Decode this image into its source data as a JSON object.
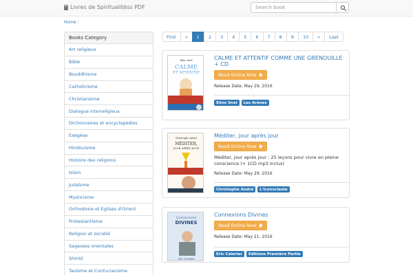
{
  "header": {
    "brand": "Livres de Spiritualitéss PDF",
    "search_placeholder": "Search book"
  },
  "breadcrumb": {
    "home": "Home",
    "separator": "/"
  },
  "sidebar": {
    "title": "Books Category",
    "items": [
      "Art religieux",
      "Bible",
      "Bouddhisme",
      "Catholicisme",
      "Christianisme",
      "Dialogue interreligieux",
      "Dictionnaires et encyclopédies",
      "Exégèse",
      "Hindouisme",
      "Histoire des religions",
      "Islam",
      "Judaïsme",
      "Mysticisme",
      "Orthodoxie et Eglises d'Orient",
      "Protestantisme",
      "Religion et société",
      "Sagesses orientales",
      "Shintô",
      "Taoïsme et Confucianisme"
    ]
  },
  "pagination": [
    "First",
    "«",
    "1",
    "2",
    "3",
    "4",
    "5",
    "6",
    "7",
    "8",
    "9",
    "10",
    "»",
    "Last"
  ],
  "pagination_active": "1",
  "read_button_label": "Read Online Now",
  "books": [
    {
      "title": "CALME ET ATTENTIF COMME UNE GRENOUILLE + CD",
      "description": "",
      "release_date": "Release Date: May 29, 2016",
      "tags": [
        "Eline Snel",
        "Les Arènes"
      ],
      "cover": {
        "author": "Eline Snel",
        "line1": "CALME",
        "line2": "ET ATTENTIF",
        "color": "#5ea0d6"
      }
    },
    {
      "title": "Méditer, jour après jour",
      "description": "Méditer, jour après jour : 25 leçons pour vivre en pleine conscience (+ 1CD mp3 inclus)",
      "release_date": "Release Date: May 29, 2016",
      "tags": [
        "Christophe André",
        "L'Iconoclaste"
      ],
      "cover": {
        "author": "Christophe André",
        "line1": "MÉDITER,",
        "line2": "JOUR APRÈS JOUR",
        "color": "#c0392b"
      }
    },
    {
      "title": "Connexions Divines",
      "description": "",
      "release_date": "Release Date: May 21, 2016",
      "tags": [
        "Eric Celerier",
        "Editions Première Partie"
      ],
      "cover": {
        "author": "ERIC CELERIER",
        "line1": "Connexions",
        "line2": "DIVINES",
        "color": "#4a6fa5"
      }
    }
  ],
  "colors": {
    "link": "#337ab7",
    "button": "#f0ad4e",
    "tag": "#337ab7"
  }
}
